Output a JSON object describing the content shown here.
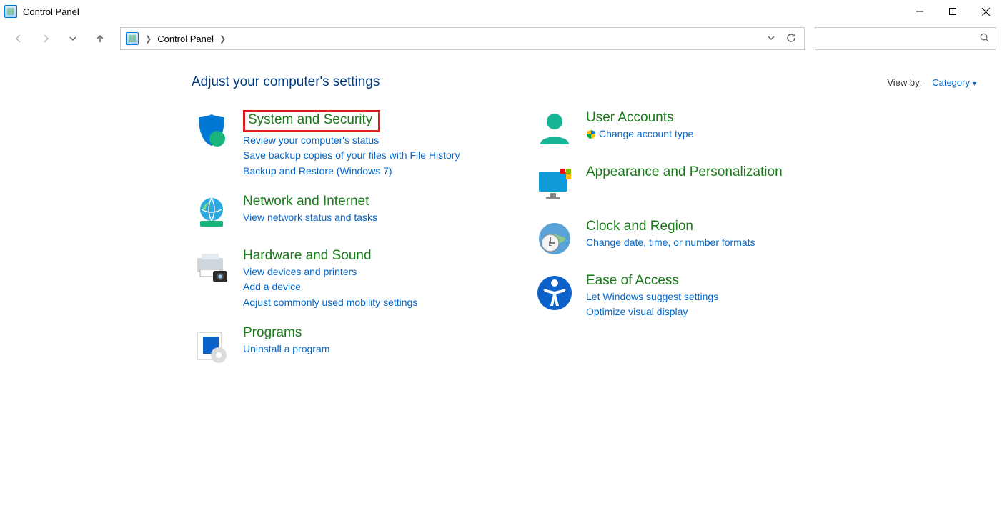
{
  "window": {
    "title": "Control Panel"
  },
  "address": {
    "text": "Control Panel"
  },
  "header": {
    "heading": "Adjust your computer's settings",
    "viewby_label": "View by:",
    "viewby_value": "Category"
  },
  "categories": {
    "left": [
      {
        "title": "System and Security",
        "highlight": true,
        "links": [
          "Review your computer's status",
          "Save backup copies of your files with File History",
          "Backup and Restore (Windows 7)"
        ]
      },
      {
        "title": "Network and Internet",
        "links": [
          "View network status and tasks"
        ]
      },
      {
        "title": "Hardware and Sound",
        "links": [
          "View devices and printers",
          "Add a device",
          "Adjust commonly used mobility settings"
        ]
      },
      {
        "title": "Programs",
        "links": [
          "Uninstall a program"
        ]
      }
    ],
    "right": [
      {
        "title": "User Accounts",
        "links": [
          {
            "text": "Change account type",
            "shield": true
          }
        ]
      },
      {
        "title": "Appearance and Personalization",
        "links": []
      },
      {
        "title": "Clock and Region",
        "links": [
          "Change date, time, or number formats"
        ]
      },
      {
        "title": "Ease of Access",
        "links": [
          "Let Windows suggest settings",
          "Optimize visual display"
        ]
      }
    ]
  }
}
